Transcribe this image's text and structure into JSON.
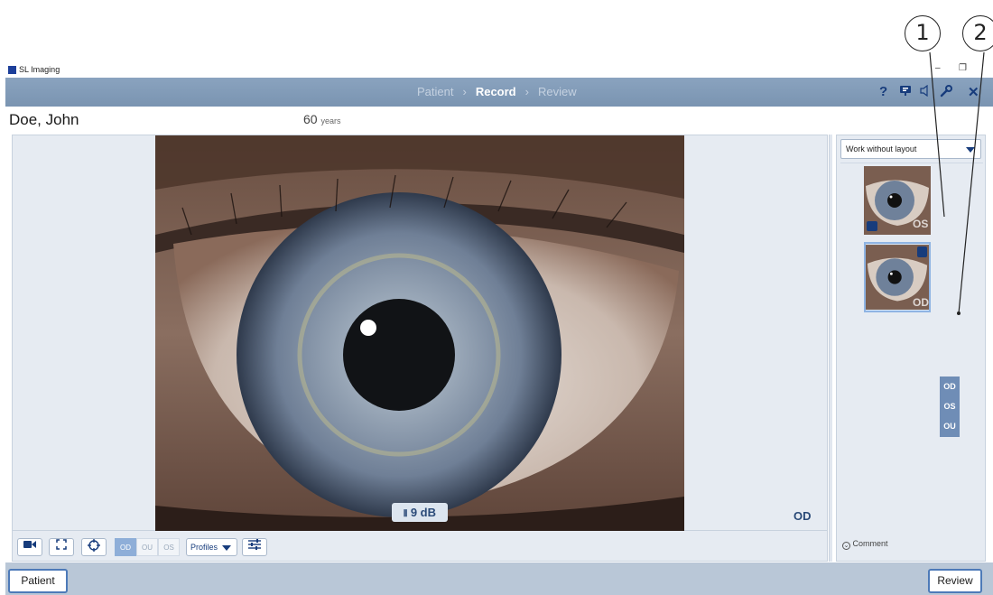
{
  "callouts": [
    "1",
    "2"
  ],
  "window": {
    "app_title": "SL Imaging",
    "minimize": "–",
    "restore": "❐"
  },
  "nav": {
    "steps": [
      "Patient",
      "Record",
      "Review"
    ],
    "active_step": "Record",
    "separator": "›",
    "icons": [
      "help-icon",
      "monitor-icon",
      "speaker-icon",
      "wrench-icon",
      "close-icon"
    ],
    "help_glyph": "?",
    "close_glyph": "✕"
  },
  "patient": {
    "name": "Doe, John",
    "age": "60",
    "age_unit": "years"
  },
  "viewer": {
    "laterality": "OD",
    "gain": "9 dB"
  },
  "toolbar": {
    "segments": [
      "OD",
      "OU",
      "OS"
    ],
    "active_segment": "OD",
    "profiles_label": "Profiles",
    "icons": [
      "video-camera-icon",
      "fullscreen-icon",
      "crosshair-icon",
      "sliders-icon"
    ]
  },
  "right_panel": {
    "layout_select": "Work without layout",
    "thumbnails": [
      {
        "laterality": "OS",
        "badge": "video-icon"
      },
      {
        "laterality": "OD",
        "badge": "delete-icon"
      }
    ],
    "laterality_menu": [
      "OD",
      "OS",
      "OU"
    ],
    "comment_label": "Comment"
  },
  "bottom": {
    "patient_button": "Patient",
    "review_button": "Review"
  }
}
